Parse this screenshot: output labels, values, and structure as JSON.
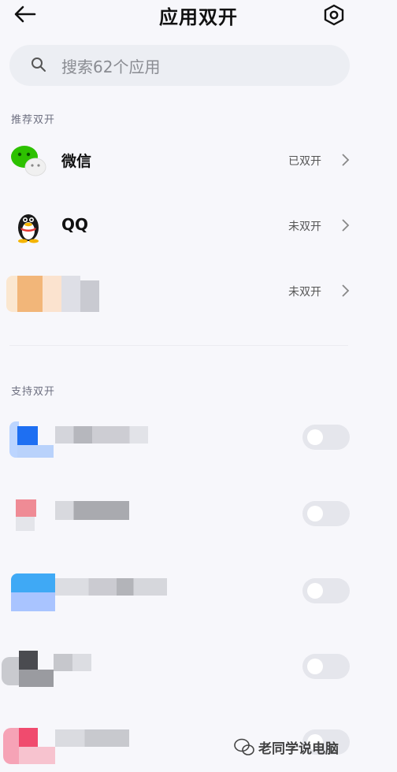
{
  "header": {
    "title": "应用双开",
    "back_icon": "arrow-left-icon",
    "settings_icon": "gear-icon"
  },
  "search": {
    "placeholder": "搜索62个应用",
    "icon": "search-icon"
  },
  "recommended": {
    "label": "推荐双开",
    "apps": [
      {
        "name": "微信",
        "status": "已双开",
        "icon": "wechat-icon"
      },
      {
        "name": "QQ",
        "status": "未双开",
        "icon": "qq-penguin-icon"
      },
      {
        "name": "",
        "status": "未双开",
        "icon": "blurred-app-icon"
      }
    ]
  },
  "supported": {
    "label": "支持双开",
    "apps": [
      {
        "toggle": "off"
      },
      {
        "toggle": "off"
      },
      {
        "toggle": "off"
      },
      {
        "toggle": "off"
      },
      {
        "toggle": "off"
      }
    ]
  },
  "watermark": {
    "text": "老同学说电脑"
  },
  "colors": {
    "background": "#f7f7fb",
    "search_bg": "#eceef3",
    "toggle_off": "#e5e6ec",
    "wechat": "#2dc100",
    "qq": "#1a1a1a"
  }
}
